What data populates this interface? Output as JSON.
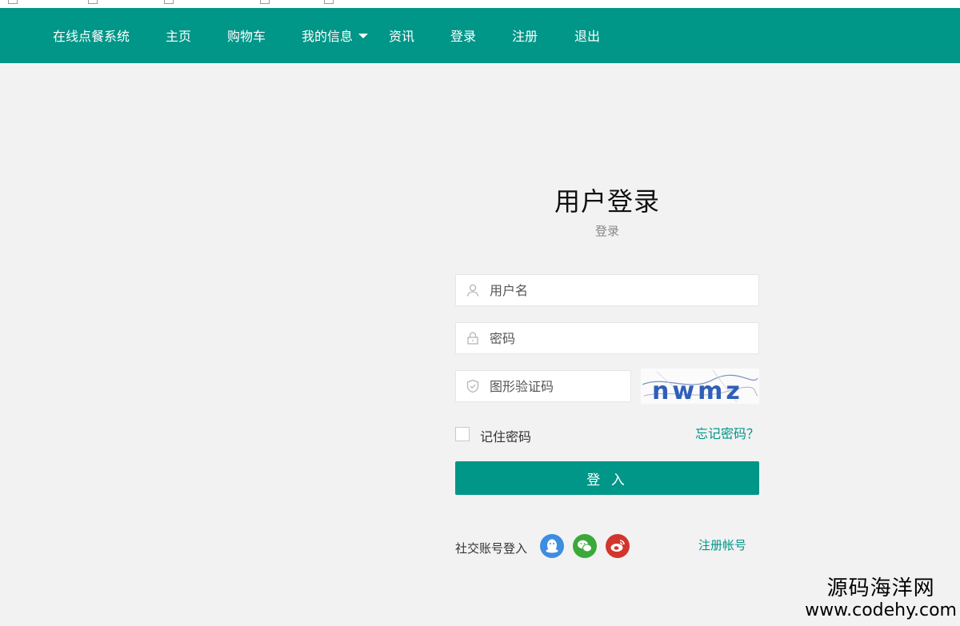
{
  "navbar": {
    "brand": "在线点餐系统",
    "items": [
      {
        "label": "主页"
      },
      {
        "label": "购物车"
      },
      {
        "label": "我的信息"
      },
      {
        "label": "资讯"
      },
      {
        "label": "登录"
      },
      {
        "label": "注册"
      },
      {
        "label": "退出"
      }
    ],
    "color": "#009688"
  },
  "login": {
    "title": "用户登录",
    "subtitle": "登录",
    "username_placeholder": "用户名",
    "password_placeholder": "密码",
    "captcha_placeholder": "图形验证码",
    "captcha_text": "nwmz",
    "remember_label": "记住密码",
    "forgot_label": "忘记密码？",
    "submit_label": "登 入",
    "social_label": "社交账号登入",
    "register_label": "注册帐号"
  },
  "watermark": {
    "name": "源码海洋网",
    "url": "www.codehy.com"
  },
  "icons": [
    "user-icon",
    "lock-icon",
    "shield-icon",
    "qq-icon",
    "wechat-icon",
    "weibo-icon",
    "chevron-down-icon"
  ]
}
